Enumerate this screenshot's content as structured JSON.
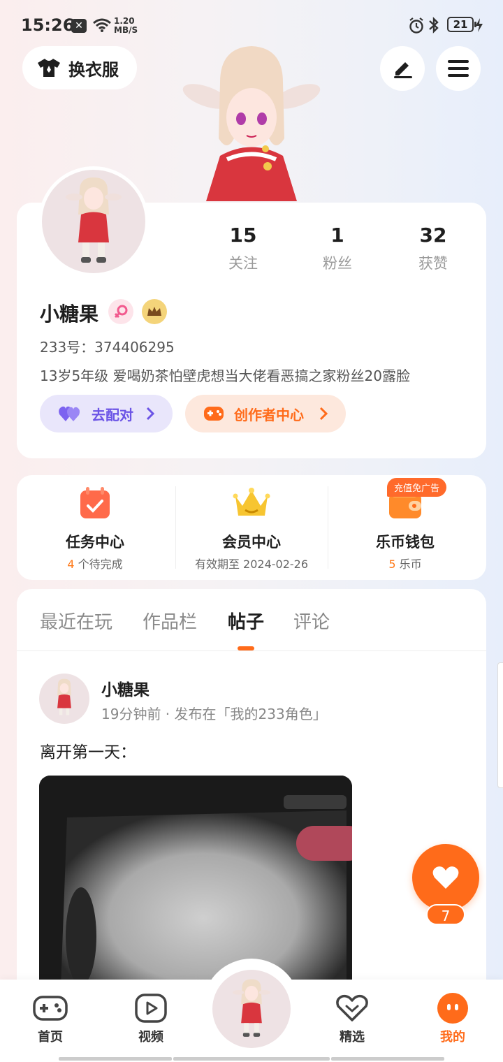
{
  "status_bar": {
    "time": "15:26",
    "net_speed_value": "1.20",
    "net_speed_unit": "MB/S",
    "battery": "21"
  },
  "header": {
    "outfit_label": "换衣服"
  },
  "profile": {
    "stats": [
      {
        "value": "15",
        "label": "关注"
      },
      {
        "value": "1",
        "label": "粉丝"
      },
      {
        "value": "32",
        "label": "获赞"
      }
    ],
    "username": "小糖果",
    "uid": "233号：374406295",
    "bio": "13岁5年级 爱喝奶茶怕壁虎想当大佬看恶搞之家粉丝20露脸",
    "match_label": "去配对",
    "creator_label": "创作者中心"
  },
  "quick": {
    "task_title": "任务中心",
    "task_count": "4",
    "task_suffix": "个待完成",
    "member_title": "会员中心",
    "member_sub": "有效期至 2024-02-26",
    "wallet_title": "乐币钱包",
    "wallet_count": "5",
    "wallet_suffix": "乐币",
    "promo_tag": "充值免广告"
  },
  "tabs": [
    {
      "label": "最近在玩"
    },
    {
      "label": "作品栏"
    },
    {
      "label": "帖子"
    },
    {
      "label": "评论"
    }
  ],
  "post": {
    "author": "小糖果",
    "meta": "19分钟前 · 发布在「我的233角色」",
    "text": "离开第一天："
  },
  "like": {
    "count": "7"
  },
  "nav": [
    {
      "label": "首页"
    },
    {
      "label": "视频"
    },
    {
      "label": "精选"
    },
    {
      "label": "我的"
    }
  ],
  "colors": {
    "accent": "#ff6b1a",
    "match_purple": "#6c55e6",
    "gold": "#f4c53a"
  }
}
